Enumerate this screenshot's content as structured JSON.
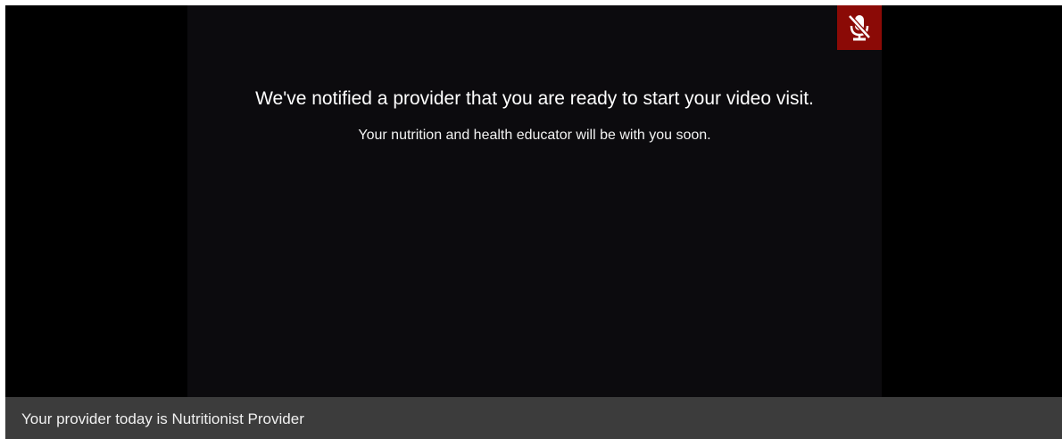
{
  "video": {
    "headline": "We've notified a provider that you are ready to start your video visit.",
    "subline": "Your nutrition and health educator will be with you soon.",
    "mute_button": {
      "icon": "microphone-muted-icon",
      "color": "#8b0a06"
    }
  },
  "footer": {
    "provider_text": "Your provider today is Nutritionist Provider"
  }
}
